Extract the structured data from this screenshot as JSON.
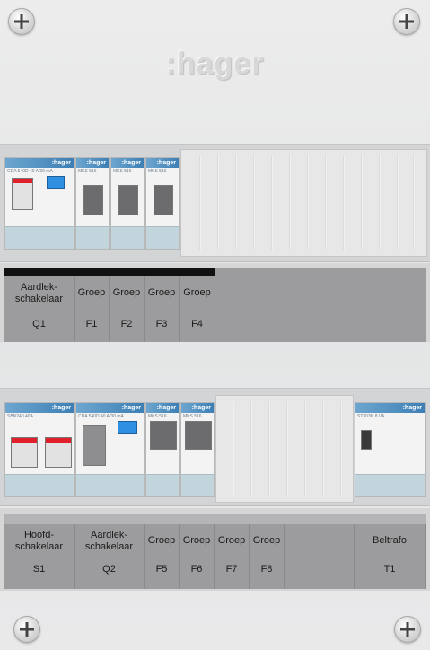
{
  "brand": {
    "logo_text": ":hager"
  },
  "row1": {
    "modules": [
      {
        "head": ":hager",
        "text": "CDA 540D 40 A/30 mA"
      },
      {
        "head": ":hager",
        "text": "MKS 516"
      },
      {
        "head": ":hager",
        "text": "MKS 516"
      },
      {
        "head": ":hager",
        "text": "MKS 516"
      }
    ],
    "labels": [
      {
        "line1": "Aardlek-",
        "line2": "schakelaar",
        "id": "Q1"
      },
      {
        "line1": "Groep",
        "line2": "",
        "id": "F1"
      },
      {
        "line1": "Groep",
        "line2": "",
        "id": "F2"
      },
      {
        "line1": "Groep",
        "line2": "",
        "id": "F3"
      },
      {
        "line1": "Groep",
        "line2": "",
        "id": "F4"
      }
    ]
  },
  "row2": {
    "modules": [
      {
        "head": ":hager",
        "text": "SBN240 40A"
      },
      {
        "head": ":hager",
        "text": "CDA 540D 40 A/30 mA"
      },
      {
        "head": ":hager",
        "text": "MKS 516"
      },
      {
        "head": ":hager",
        "text": "MKS 516"
      },
      {
        "head": ":hager",
        "text": "ST303N 8 VA"
      }
    ],
    "labels": [
      {
        "line1": "Hoofd-",
        "line2": "schakelaar",
        "id": "S1"
      },
      {
        "line1": "Aardlek-",
        "line2": "schakelaar",
        "id": "Q2"
      },
      {
        "line1": "Groep",
        "line2": "",
        "id": "F5"
      },
      {
        "line1": "Groep",
        "line2": "",
        "id": "F6"
      },
      {
        "line1": "Groep",
        "line2": "",
        "id": "F7"
      },
      {
        "line1": "Groep",
        "line2": "",
        "id": "F8"
      },
      {
        "line1": "Beltrafo",
        "line2": "",
        "id": "T1"
      }
    ]
  }
}
